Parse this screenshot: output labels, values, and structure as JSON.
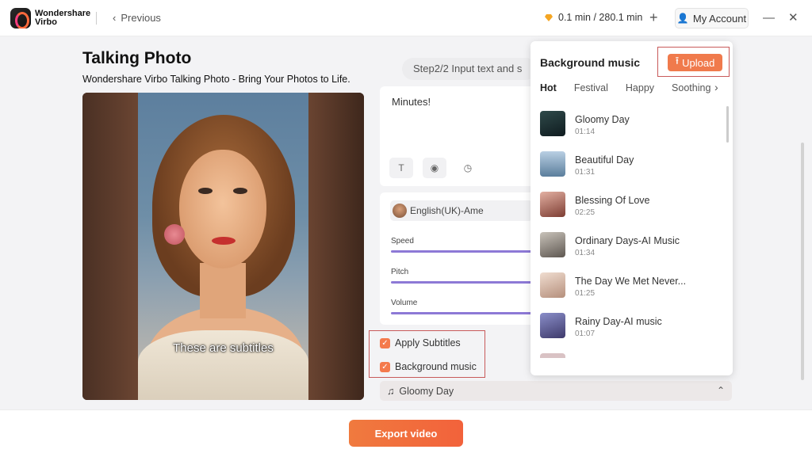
{
  "app": {
    "brand_line1": "Wondershare",
    "brand_line2": "Virbo",
    "previous_label": "Previous",
    "usage": "0.1 min / 280.1 min",
    "add_label": "+",
    "account_label": "My Account",
    "minimize_label": "—",
    "close_label": "✕"
  },
  "page": {
    "title": "Talking Photo",
    "subtitle": "Wondershare Virbo Talking Photo - Bring Your Photos to Life.",
    "subtitle_overlay": "These are subtitles"
  },
  "editor": {
    "step_label": "Step2/2 Input text and s",
    "script_text": "Minutes!",
    "voice_label": "English(UK)-Ame",
    "speed_label": "Speed",
    "pitch_label": "Pitch",
    "volume_label": "Volume",
    "apply_subtitles_label": "Apply Subtitles",
    "apply_subtitles_checked": true,
    "background_music_label": "Background music",
    "background_music_checked": true,
    "selected_music": "Gloomy Day"
  },
  "music_popup": {
    "title": "Background music",
    "upload_label": "Upload",
    "tabs": [
      "Hot",
      "Festival",
      "Happy",
      "Soothing"
    ],
    "active_tab": "Hot",
    "tracks": [
      {
        "name": "Gloomy Day",
        "duration": "01:14"
      },
      {
        "name": "Beautiful Day",
        "duration": "01:31"
      },
      {
        "name": "Blessing Of Love",
        "duration": "02:25"
      },
      {
        "name": "Ordinary Days-AI Music",
        "duration": "01:34"
      },
      {
        "name": "The Day We Met Never...",
        "duration": "01:25"
      },
      {
        "name": "Rainy Day-AI music",
        "duration": "01:07"
      }
    ]
  },
  "footer": {
    "export_label": "Export video"
  },
  "colors": {
    "accent": "#f07a3e",
    "slider": "#8d79d6",
    "highlight_box": "#c85a5a"
  }
}
